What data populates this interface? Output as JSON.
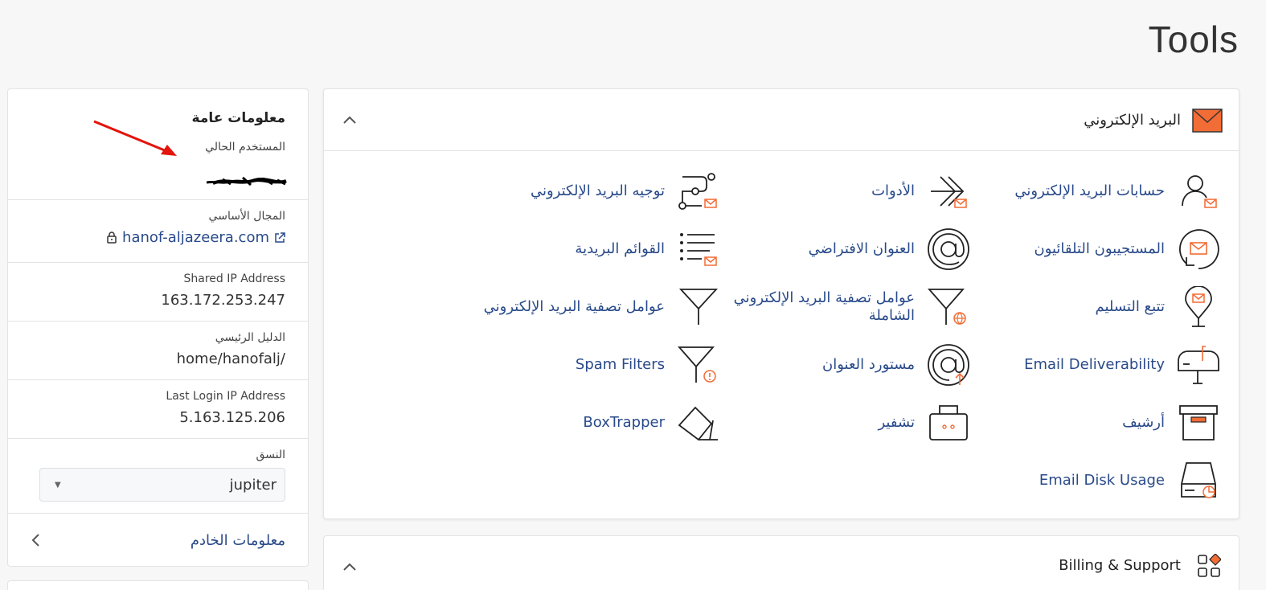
{
  "page_title": "Tools",
  "sidebar": {
    "title": "معلومات عامة",
    "current_user_label": "المستخدم الحالي",
    "primary_domain_label": "المجال الأساسي",
    "primary_domain": "hanof-aljazeera.com",
    "shared_ip_label": "Shared IP Address",
    "shared_ip": "163.172.253.247",
    "home_dir_label": "الدليل الرئيسي",
    "home_dir": "home/hanofalj/",
    "last_login_label": "Last Login IP Address",
    "last_login_ip": "5.163.125.206",
    "theme_label": "النسق",
    "theme_value": "jupiter",
    "server_info": "معلومات الخادم"
  },
  "email_section": {
    "title": "البريد الإلكتروني",
    "items": [
      {
        "label": "حسابات البريد الإلكتروني",
        "icon": "email-accounts-icon"
      },
      {
        "label": "الأدوات",
        "icon": "forwarders-icon"
      },
      {
        "label": "توجيه البريد الإلكتروني",
        "icon": "email-routing-icon"
      },
      {
        "label": "المستجيبون التلقائيون",
        "icon": "autoresponders-icon"
      },
      {
        "label": "العنوان الافتراضي",
        "icon": "default-address-icon"
      },
      {
        "label": "القوائم البريدية",
        "icon": "mailing-lists-icon"
      },
      {
        "label": "تتبع التسليم",
        "icon": "track-delivery-icon"
      },
      {
        "label": "عوامل تصفية البريد الإلكتروني الشاملة",
        "icon": "global-filters-icon"
      },
      {
        "label": "عوامل تصفية البريد الإلكتروني",
        "icon": "email-filters-icon"
      },
      {
        "label": "Email Deliverability",
        "icon": "deliverability-icon"
      },
      {
        "label": "مستورد العنوان",
        "icon": "address-importer-icon"
      },
      {
        "label": "Spam Filters",
        "icon": "spam-filters-icon"
      },
      {
        "label": "أرشيف",
        "icon": "archive-icon"
      },
      {
        "label": "تشفير",
        "icon": "encryption-icon"
      },
      {
        "label": "BoxTrapper",
        "icon": "boxtrapper-icon"
      },
      {
        "label": "Email Disk Usage",
        "icon": "disk-usage-icon"
      }
    ]
  },
  "billing_section": {
    "title": "Billing & Support"
  },
  "colors": {
    "link": "#294a8a",
    "accent": "#f26c35",
    "annotation_arrow": "#e3140c"
  }
}
